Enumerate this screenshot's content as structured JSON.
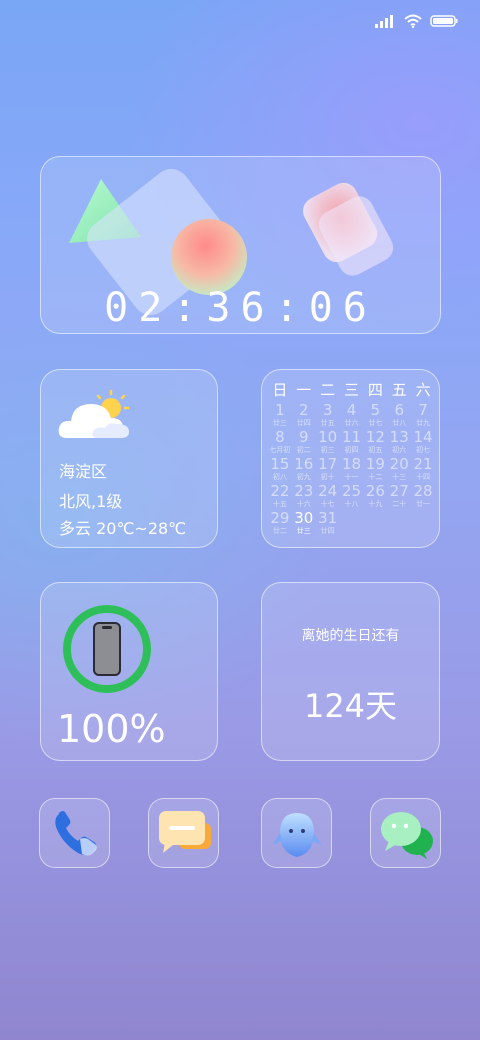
{
  "status_bar": {
    "icons": [
      "cellular-signal-icon",
      "wifi-icon",
      "battery-icon"
    ]
  },
  "clock": {
    "time": [
      "0",
      "2",
      ":",
      "3",
      "6",
      ":",
      "0",
      "6"
    ]
  },
  "weather": {
    "icon": "partly-cloudy-icon",
    "district": "海淀区",
    "wind": "北风,1级",
    "condition": "多云 20℃~28℃"
  },
  "calendar": {
    "weekdays": [
      "日",
      "一",
      "二",
      "三",
      "四",
      "五",
      "六"
    ],
    "today": "30",
    "days": [
      {
        "num": "1",
        "lunar": "廿三"
      },
      {
        "num": "2",
        "lunar": "廿四"
      },
      {
        "num": "3",
        "lunar": "廿五"
      },
      {
        "num": "4",
        "lunar": "廿六"
      },
      {
        "num": "5",
        "lunar": "廿七"
      },
      {
        "num": "6",
        "lunar": "廿八"
      },
      {
        "num": "7",
        "lunar": "廿九"
      },
      {
        "num": "8",
        "lunar": "七月初"
      },
      {
        "num": "9",
        "lunar": "初二"
      },
      {
        "num": "10",
        "lunar": "初三"
      },
      {
        "num": "11",
        "lunar": "初四"
      },
      {
        "num": "12",
        "lunar": "初五"
      },
      {
        "num": "13",
        "lunar": "初六"
      },
      {
        "num": "14",
        "lunar": "初七"
      },
      {
        "num": "15",
        "lunar": "初八"
      },
      {
        "num": "16",
        "lunar": "初九"
      },
      {
        "num": "17",
        "lunar": "初十"
      },
      {
        "num": "18",
        "lunar": "十一"
      },
      {
        "num": "19",
        "lunar": "十二"
      },
      {
        "num": "20",
        "lunar": "十三"
      },
      {
        "num": "21",
        "lunar": "十四"
      },
      {
        "num": "22",
        "lunar": "十五"
      },
      {
        "num": "23",
        "lunar": "十六"
      },
      {
        "num": "24",
        "lunar": "十七"
      },
      {
        "num": "25",
        "lunar": "十八"
      },
      {
        "num": "26",
        "lunar": "十九"
      },
      {
        "num": "27",
        "lunar": "二十"
      },
      {
        "num": "28",
        "lunar": "廿一"
      },
      {
        "num": "29",
        "lunar": "廿二"
      },
      {
        "num": "30",
        "lunar": "廿三"
      },
      {
        "num": "31",
        "lunar": "廿四"
      }
    ]
  },
  "battery": {
    "level": 1.0,
    "percent_label": "100%",
    "ring_color": "#2fbf5a",
    "icon": "phone-device-icon"
  },
  "countdown": {
    "label": "离她的生日还有",
    "value": "124天"
  },
  "dock": {
    "apps": [
      {
        "name": "phone",
        "icon": "phone-app-icon"
      },
      {
        "name": "messages",
        "icon": "messages-app-icon"
      },
      {
        "name": "assistant",
        "icon": "assistant-app-icon"
      },
      {
        "name": "wechat",
        "icon": "wechat-app-icon"
      }
    ]
  }
}
